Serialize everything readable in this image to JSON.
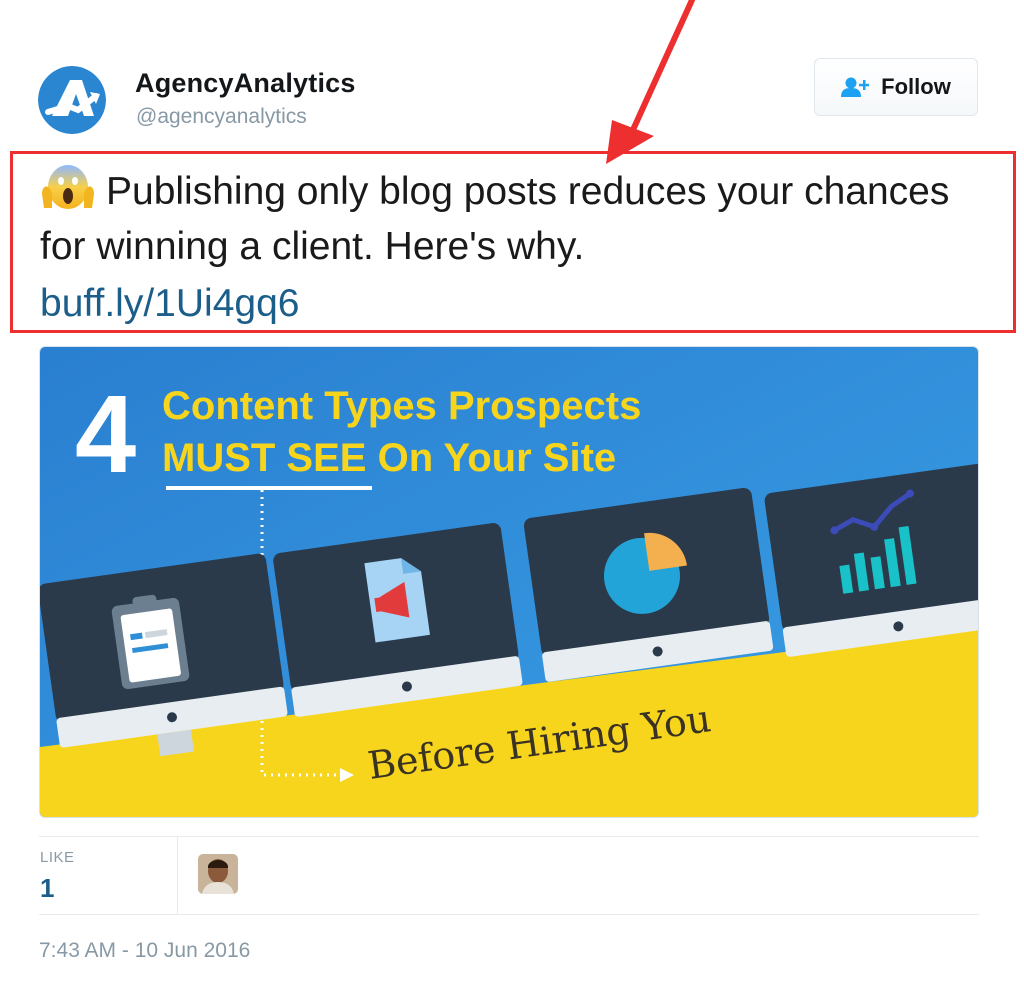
{
  "user": {
    "display_name": "AgencyAnalytics",
    "handle": "@agencyanalytics",
    "avatar_icon": "agencyanalytics-logo-icon"
  },
  "follow_button": {
    "label": "Follow",
    "icon": "add-user-icon"
  },
  "tweet": {
    "emoji": "screaming-face-emoji",
    "text": "Publishing only blog posts reduces your chances for winning a client. Here's why.",
    "link": "buff.ly/1Ui4gq6"
  },
  "media": {
    "headline_number": "4",
    "headline_line1": "Content Types Prospects",
    "headline_line2": "MUST SEE On Your Site",
    "footer_text": "Before Hiring You",
    "colors": {
      "background": "#2f8fd6",
      "accent_yellow": "#f7d51d",
      "dark_screen": "#2b3a4a"
    }
  },
  "stats": {
    "likes_label": "LIKE",
    "likes_count": "1"
  },
  "timestamp": "7:43 AM - 10 Jun 2016",
  "annotation": {
    "color": "#ed2f2f"
  }
}
